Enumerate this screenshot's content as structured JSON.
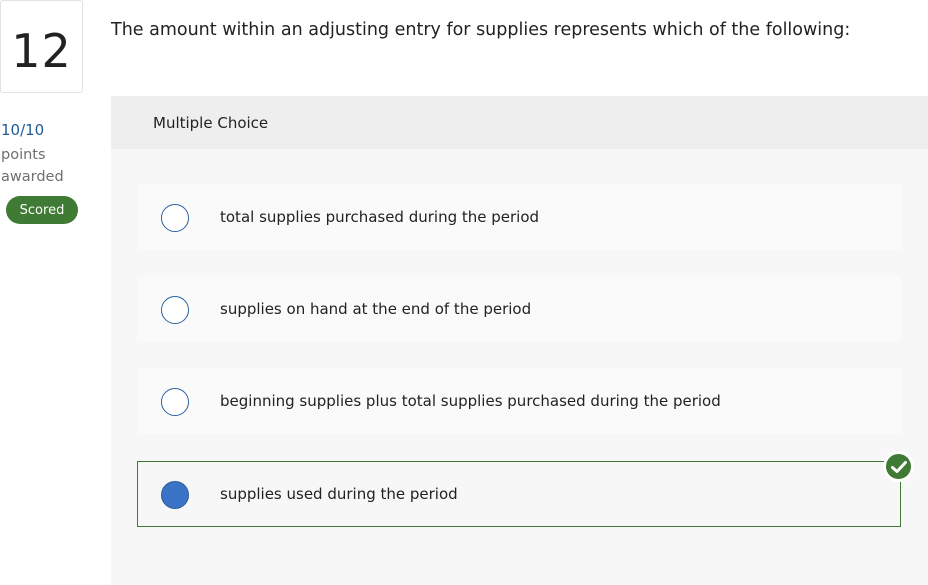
{
  "question": {
    "number": "12",
    "text": "The amount within an adjusting entry for supplies represents which of the following:"
  },
  "score": {
    "points_value": "10/10",
    "points_label": "points awarded",
    "status_badge": "Scored"
  },
  "answer_panel": {
    "type_label": "Multiple Choice",
    "options": [
      {
        "label": "total supplies purchased during the period",
        "selected": false
      },
      {
        "label": "supplies on hand at the end of the period",
        "selected": false
      },
      {
        "label": "beginning supplies plus total supplies purchased during the period",
        "selected": false
      },
      {
        "label": "supplies used during the period",
        "selected": true,
        "correct": true
      }
    ]
  },
  "colors": {
    "accent_green": "#3f7b34",
    "radio_blue": "#3b74c6",
    "link_blue": "#1f5a96"
  },
  "icons": {
    "correct_indicator": "checkmark-icon"
  }
}
